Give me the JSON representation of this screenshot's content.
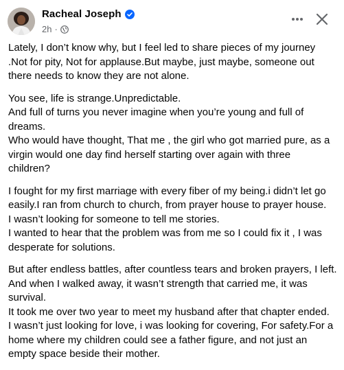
{
  "post": {
    "author": "Racheal Joseph",
    "time": "2h",
    "separator": "·",
    "paragraphs": [
      "Lately, I don’t know why, but I feel led to share pieces of my journey\n.Not for pity, Not for applause.But maybe, just maybe, someone out\nthere needs to know they are not alone.",
      "You see, life is strange.Unpredictable.\nAnd full of turns you never imagine when you’re young and full of\ndreams.\nWho would have thought, That me , the girl who got married pure, as a\nvirgin would one day find herself starting over again with three\nchildren?",
      "I fought for my first marriage with every fiber of my being.i didn’t let go\neasily.I ran from church to church, from prayer house to prayer house.\nI wasn’t looking for someone to tell me stories.\nI wanted to hear that the problem was from me so I could fix it , I was\ndesperate for solutions.",
      "But after endless battles, after countless tears and broken prayers, I left.\nAnd when I walked away, it wasn’t strength that carried me, it was\nsurvival.\nIt took me over two year to meet my husband after that chapter ended.\nI wasn’t just looking for love, i was looking for covering, For safety.For a\nhome where my children could see a father figure, and not just an\nempty space beside their mother."
    ]
  },
  "icons": {
    "verified": "verified-badge-icon",
    "globe": "globe-icon",
    "more": "more-options-icon",
    "close": "close-icon"
  },
  "colors": {
    "verified_blue": "#0866ff",
    "meta_gray": "#65676b",
    "text": "#050505"
  }
}
